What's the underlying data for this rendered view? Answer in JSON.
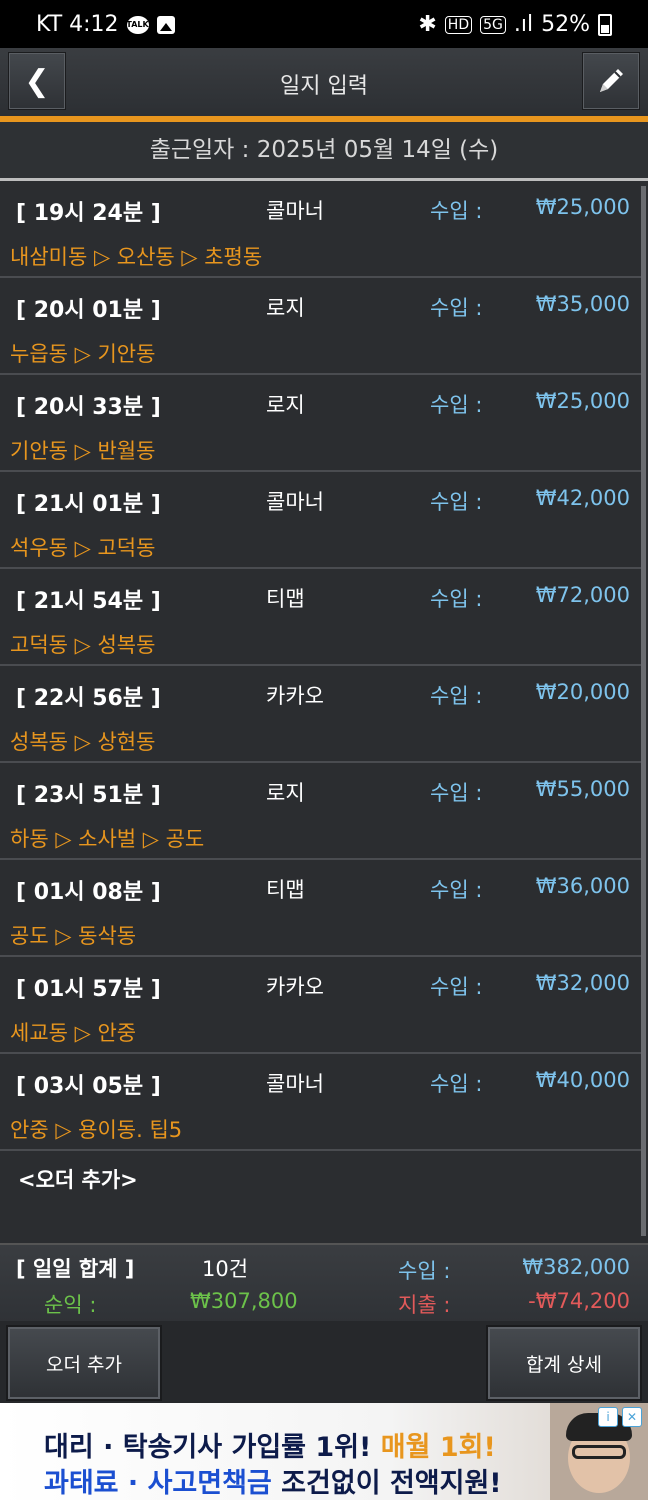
{
  "statusbar": {
    "carrier_time": "KT 4:12",
    "talk": "TALK",
    "hd": "HD",
    "net": "5G",
    "signal": ".ıl",
    "battery": "52%"
  },
  "header": {
    "title": "일지 입력",
    "back_glyph": "❮"
  },
  "work_date": "출근일자 : 2025년 05월 14일 (수)",
  "income_label": "수입 :",
  "orders": [
    {
      "time": "[ 19시 24분 ]",
      "company": "콜마너",
      "amount": "₩25,000",
      "route": "내삼미동 ▷ 오산동 ▷ 초평동"
    },
    {
      "time": "[ 20시 01분 ]",
      "company": "로지",
      "amount": "₩35,000",
      "route": "누읍동 ▷ 기안동"
    },
    {
      "time": "[ 20시 33분 ]",
      "company": "로지",
      "amount": "₩25,000",
      "route": "기안동 ▷ 반월동"
    },
    {
      "time": "[ 21시 01분 ]",
      "company": "콜마너",
      "amount": "₩42,000",
      "route": "석우동 ▷ 고덕동"
    },
    {
      "time": "[ 21시 54분 ]",
      "company": "티맵",
      "amount": "₩72,000",
      "route": "고덕동 ▷ 성복동"
    },
    {
      "time": "[ 22시 56분 ]",
      "company": "카카오",
      "amount": "₩20,000",
      "route": "성복동 ▷ 상현동"
    },
    {
      "time": "[ 23시 51분 ]",
      "company": "로지",
      "amount": "₩55,000",
      "route": "하동 ▷ 소사벌 ▷ 공도"
    },
    {
      "time": "[ 01시 08분 ]",
      "company": "티맵",
      "amount": "₩36,000",
      "route": "공도 ▷ 동삭동"
    },
    {
      "time": "[ 01시 57분 ]",
      "company": "카카오",
      "amount": "₩32,000",
      "route": "세교동 ▷ 안중"
    },
    {
      "time": "[ 03시 05분 ]",
      "company": "콜마너",
      "amount": "₩40,000",
      "route": "안중 ▷ 용이동.   팁5"
    }
  ],
  "add_order_item": "<오더 추가>",
  "summary": {
    "title": "[ 일일 합계 ]",
    "count": "10건",
    "income_label": "수입 :",
    "income": "₩382,000",
    "net_label": "순익 :",
    "net": "₩307,800",
    "expense_label": "지출 :",
    "expense": "-₩74,200"
  },
  "buttons": {
    "add_order": "오더 추가",
    "total_detail": "합계 상세"
  },
  "ad": {
    "line1_a": "대리 · 탁송기사 가입률 1위! ",
    "line1_b": "매월 1회!",
    "line2_a": "과태료 · 사고면책금",
    "line2_b": " 조건없이 전액지원!"
  },
  "colors": {
    "accent": "#e8961e",
    "income": "#7ec3ec",
    "net": "#6cc24a",
    "expense": "#e25a5a"
  }
}
